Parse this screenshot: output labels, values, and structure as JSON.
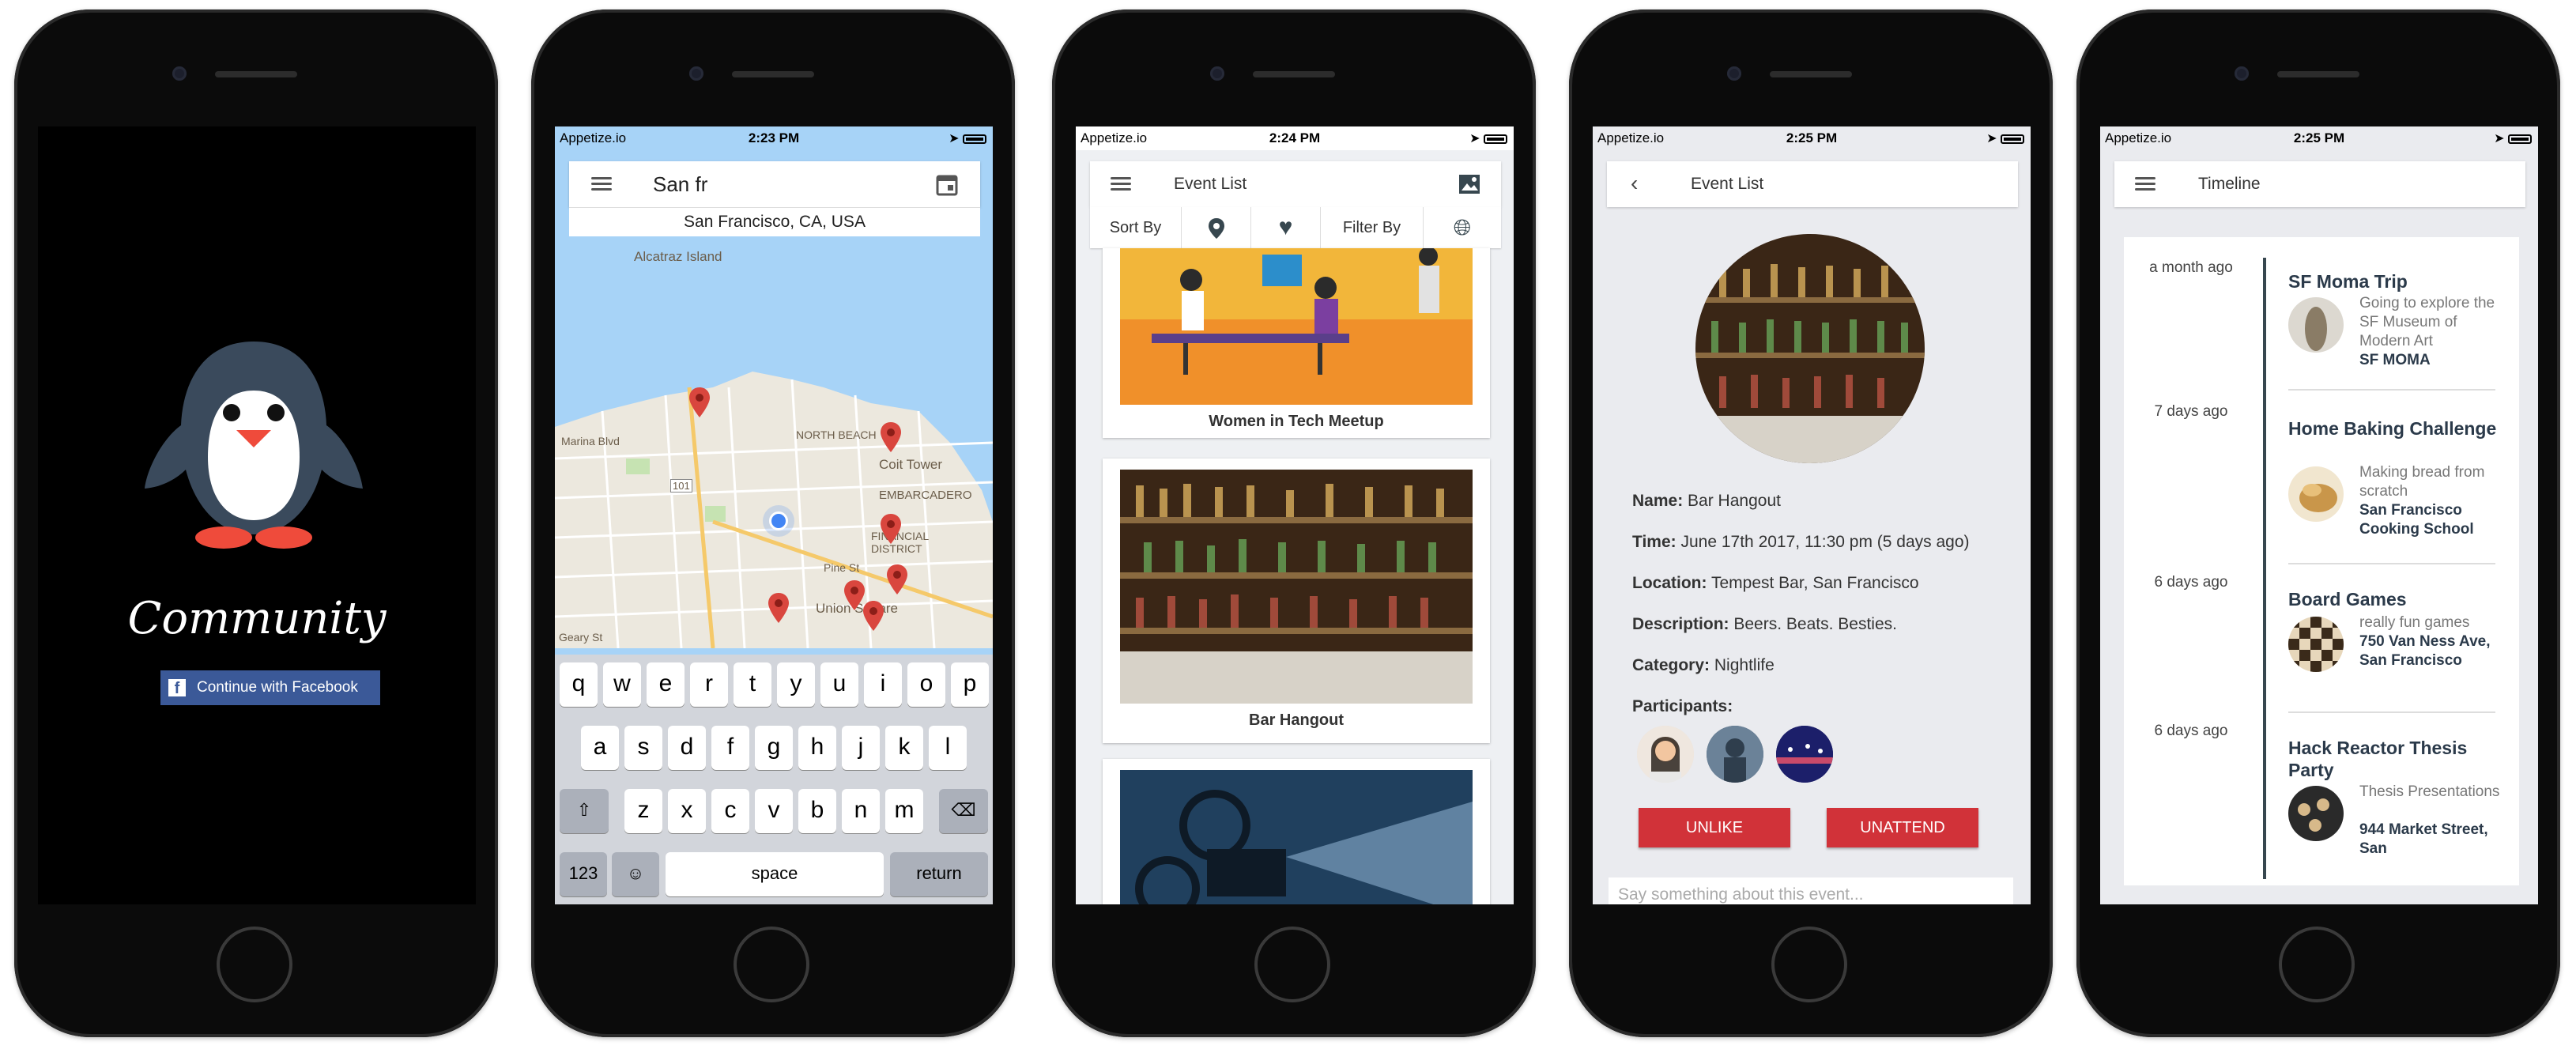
{
  "status": {
    "carrier": "Appetize.io",
    "times": [
      "2:23 PM",
      "2:24 PM",
      "2:25 PM",
      "2:25 PM"
    ]
  },
  "login": {
    "app_name": "Community",
    "fb_button": "Continue with Facebook"
  },
  "map": {
    "search_value": "San fr",
    "suggestion": "San Francisco, CA, USA",
    "labels": [
      "Alcatraz Island",
      "NORTH BEACH",
      "Coit Tower",
      "EMBARCADERO",
      "Marina Blvd",
      "FINANCIAL DISTRICT",
      "Pine St",
      "Union Square",
      "Geary St",
      "101"
    ],
    "keyboard": {
      "row1": [
        "q",
        "w",
        "e",
        "r",
        "t",
        "y",
        "u",
        "i",
        "o",
        "p"
      ],
      "row2": [
        "a",
        "s",
        "d",
        "f",
        "g",
        "h",
        "j",
        "k",
        "l"
      ],
      "row3": [
        "z",
        "x",
        "c",
        "v",
        "b",
        "n",
        "m"
      ],
      "num": "123",
      "space": "space",
      "return": "return"
    }
  },
  "event_list": {
    "title": "Event List",
    "sort_by": "Sort By",
    "filter_by": "Filter By",
    "cards": [
      "Women in Tech Meetup",
      "Bar Hangout"
    ]
  },
  "event_detail": {
    "title": "Event List",
    "fields": [
      {
        "label": "Name:",
        "value": "Bar Hangout"
      },
      {
        "label": "Time:",
        "value": "June 17th 2017, 11:30 pm (5 days ago)"
      },
      {
        "label": "Location:",
        "value": "Tempest Bar, San Francisco"
      },
      {
        "label": "Description:",
        "value": "Beers. Beats. Besties."
      },
      {
        "label": "Category:",
        "value": "Nightlife"
      }
    ],
    "participants_label": "Participants:",
    "unlike": "UNLIKE",
    "unattend": "UNATTEND",
    "comment_placeholder": "Say something about this event..."
  },
  "timeline": {
    "title": "Timeline",
    "items": [
      {
        "ago": "a month ago",
        "title": "SF Moma Trip",
        "desc": "Going to explore the SF Museum of Modern Art",
        "location": "SF MOMA"
      },
      {
        "ago": "7 days ago",
        "title": "Home Baking Challenge",
        "desc": "Making bread from scratch",
        "location": "San Francisco Cooking School"
      },
      {
        "ago": "6 days ago",
        "title": "Board Games",
        "desc": "really fun games",
        "location": "750 Van Ness Ave, San Francisco"
      },
      {
        "ago": "6 days ago",
        "title": "Hack Reactor Thesis Party",
        "desc": "Thesis Presentations",
        "location": "944 Market Street, San"
      }
    ]
  },
  "colors": {
    "facebook": "#3b5998",
    "accent_red": "#d13239",
    "pin_red": "#d9463e",
    "map_water": "#a7d3f7"
  }
}
